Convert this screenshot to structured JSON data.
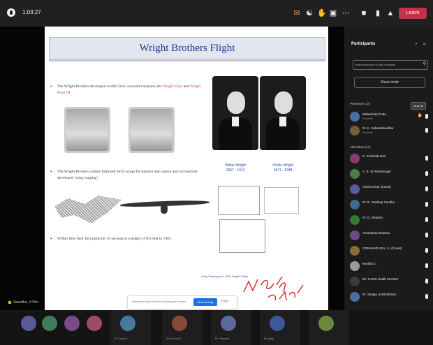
{
  "meeting": {
    "timer": "1:03:27",
    "toolbar": [
      {
        "icon": "chat-icon"
      },
      {
        "icon": "people-icon"
      },
      {
        "icon": "raise-hand-icon"
      },
      {
        "icon": "view-icon"
      },
      {
        "icon": "more-icon"
      },
      {
        "icon": "camera-icon"
      },
      {
        "icon": "mic-icon"
      },
      {
        "icon": "share-icon"
      }
    ],
    "leave_label": "Leave",
    "presenter_label": "Vasudha, Ji Shri"
  },
  "slide": {
    "title": "Wright Brothers Flight",
    "bullet1_a": "The Wright Brothers developed world's first successful airplane; the ",
    "bullet1_red": "Wright Flyer",
    "bullet1_b": " and ",
    "bullet1_red2": "Wright Flyer III.",
    "bullet2": "The Wright Brothers closely followed bird's wings for balance and control and successfully developed \"wing warping\".",
    "bullet3": "Wilbur flew their first plane for 59 seconds at a height of 852 feet in 1903.",
    "name1": "Wilbur Wright",
    "years1": "1867 - 1912",
    "name2": "Orville Wright",
    "years2": "1871 - 1948",
    "caption": "Wing Warping and 1902 Wright Glider",
    "handwriting": "wing warping"
  },
  "share_bar": {
    "text": "sanju.teams.microsoft.com is sharing your screen",
    "stop_label": "Stop sharing",
    "hide_label": "Hide"
  },
  "sidebar": {
    "title": "Participants",
    "search_placeholder": "Invite someone or dial a number",
    "share_invite": "Share invite",
    "presenters_label": "Presenters (2)",
    "mute_all": "Mute all",
    "attendees_label": "Attendees (17)",
    "participants": [
      {
        "name": "Babarchap Dutta",
        "role": "Presenter",
        "avatar": "#4a6fa5",
        "hand": true
      },
      {
        "name": "Dr. K. Sahasrabuddhe",
        "role": "Presenter",
        "avatar": "#7a5c3b",
        "hand": false
      },
      {
        "name": "D. Krishnakumar",
        "role": "",
        "avatar": "#8a3b6b",
        "hand": false
      },
      {
        "name": "A. S. Sri Ramanujan",
        "role": "",
        "avatar": "#4a7d4a",
        "hand": false
      },
      {
        "name": "Ankit Kumar (Guest)",
        "role": "",
        "avatar": "#5a5a9a",
        "hand": false
      },
      {
        "name": "Dr. B. Jasdeep Sandhu",
        "role": "",
        "avatar": "#3b6b8a",
        "hand": false
      },
      {
        "name": "Dr. G. Sharma",
        "role": "",
        "avatar": "#2e7d32",
        "hand": false
      },
      {
        "name": "Amandeep Sharma",
        "role": "",
        "avatar": "#6a4a8a",
        "hand": false
      },
      {
        "name": "GORAKHPUR K. S. (Guest)",
        "role": "",
        "avatar": "#8a6a3b",
        "hand": false
      },
      {
        "name": "Kavitha J.",
        "role": "",
        "avatar": "#9a9a9a",
        "hand": false
      },
      {
        "name": "Mr. TURKI Sudik SHAIKH",
        "role": "",
        "avatar": "#3b3b3b",
        "hand": false
      },
      {
        "name": "Dr. Sanjay Unnikrishnan",
        "role": "",
        "avatar": "#4a6fa5",
        "hand": false
      }
    ]
  },
  "strip": {
    "tiles": [
      {
        "initials": "AT",
        "color": "#5a5a9a",
        "label": ""
      },
      {
        "initials": "DH",
        "color": "#3b7d5a",
        "label": ""
      },
      {
        "initials": "MD",
        "color": "#7a4a8a",
        "label": ""
      },
      {
        "initials": "DK",
        "color": "#a04a6a",
        "label": ""
      },
      {
        "initials": "SR",
        "color": "#4a7a9a",
        "label": "Dr. Jaya S."
      },
      {
        "initials": "KS",
        "color": "#8a4a3b",
        "label": "Dr. Kumar S."
      },
      {
        "initials": "DS",
        "color": "#5a6a9a",
        "label": "Dr. Shanthi"
      },
      {
        "initials": "SA",
        "color": "#3b5a9a",
        "label": "Dr. Ajay"
      },
      {
        "initials": "MR",
        "color": "#6a8a3b",
        "label": ""
      }
    ]
  }
}
